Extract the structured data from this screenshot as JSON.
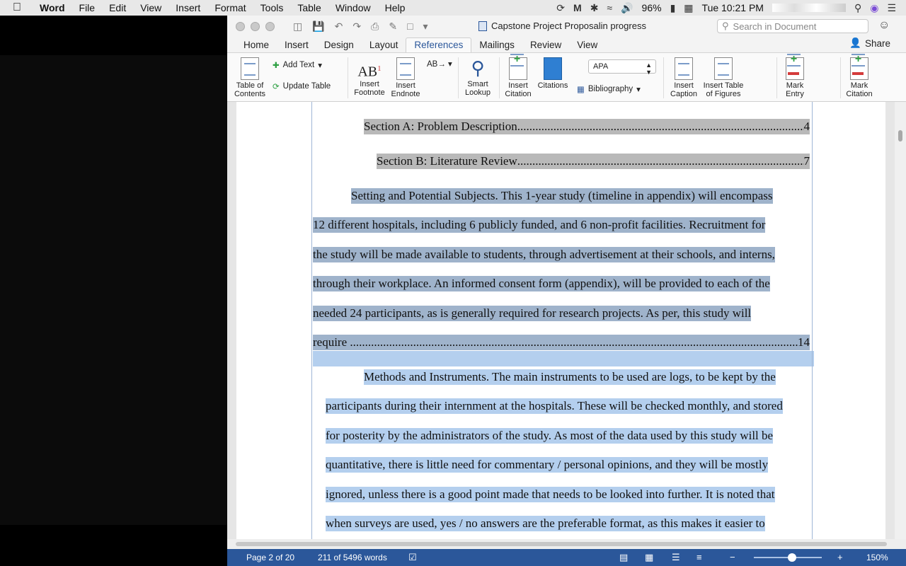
{
  "menubar": {
    "app": "Word",
    "items": [
      "File",
      "Edit",
      "View",
      "Insert",
      "Format",
      "Tools",
      "Table",
      "Window",
      "Help"
    ],
    "battery": "96%",
    "clock": "Tue 10:21 PM"
  },
  "window": {
    "title": "Capstone Project Proposalin progress",
    "search_placeholder": "Search in Document",
    "share_label": "Share",
    "tabs": [
      "Home",
      "Insert",
      "Design",
      "Layout",
      "References",
      "Mailings",
      "Review",
      "View"
    ],
    "active_tab": "References"
  },
  "ribbon": {
    "toc_label": "Table of\nContents",
    "add_text": "Add Text",
    "update_table": "Update Table",
    "insert_footnote": "Insert\nFootnote",
    "insert_endnote": "Insert\nEndnote",
    "smart_lookup": "Smart\nLookup",
    "insert_citation": "Insert\nCitation",
    "citations": "Citations",
    "style_value": "APA",
    "bibliography": "Bibliography",
    "insert_caption": "Insert\nCaption",
    "insert_table_of_figures": "Insert Table\nof Figures",
    "mark_entry": "Mark\nEntry",
    "mark_citation": "Mark\nCitation"
  },
  "document": {
    "lines": [
      {
        "text": "Section A: Problem Description",
        "toc_page": "4"
      },
      {
        "text": "Section B: Literature Review",
        "toc_page": "7"
      },
      {
        "text": "Setting and Potential Subjects. This 1-year study (timeline in appendix) will encompass"
      },
      {
        "text": "12 different hospitals, including 6 publicly funded, and 6 non-profit facilities. Recruitment for"
      },
      {
        "text": "the study will be made available to students, through advertisement at their schools, and interns,"
      },
      {
        "text": "through their workplace. An informed consent form (appendix), will be provided to each of the"
      },
      {
        "text": "needed 24 participants, as is generally required for research projects. As per, this study will"
      },
      {
        "text": "require",
        "toc_page": "14"
      },
      {
        "text": "Methods and Instruments.  The main instruments to be used are logs, to be kept by the"
      },
      {
        "text": "participants during their internment at the hospitals. These will be checked monthly, and stored"
      },
      {
        "text": "for posterity by the administrators of the study. As most of the data used by this study will be"
      },
      {
        "text": "quantitative, there is little need for commentary / personal opinions, and they will be mostly"
      },
      {
        "text": "ignored, unless there is a good point made that needs to be looked into further. It is noted that"
      },
      {
        "text": "when surveys are used, yes / no answers are the preferable format, as this makes it easier to"
      }
    ]
  },
  "status": {
    "page": "Page 2 of 20",
    "words": "211 of 5496 words",
    "zoom": "150%"
  }
}
